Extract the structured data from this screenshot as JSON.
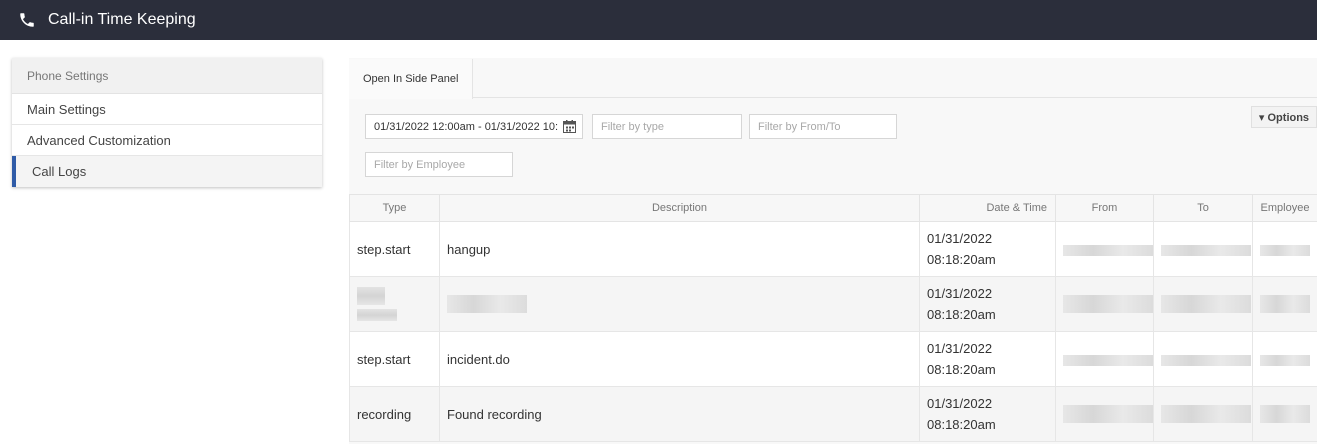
{
  "app": {
    "title": "Call-in Time Keeping",
    "icon": "phone-icon"
  },
  "sidebar": {
    "header": "Phone Settings",
    "items": [
      {
        "label": "Main Settings",
        "active": false
      },
      {
        "label": "Advanced Customization",
        "active": false
      },
      {
        "label": "Call Logs",
        "active": true
      }
    ]
  },
  "panel": {
    "tab_label": "Open In Side Panel",
    "options_label": "▾ Options"
  },
  "filters": {
    "date_range_value": "01/31/2022 12:00am - 01/31/2022 10:",
    "type_placeholder": "Filter by type",
    "from_to_placeholder": "Filter by From/To",
    "employee_placeholder": "Filter by Employee"
  },
  "table": {
    "columns": {
      "type": "Type",
      "description": "Description",
      "datetime": "Date & Time",
      "from": "From",
      "to": "To",
      "employee": "Employee"
    },
    "rows": [
      {
        "type": "step.start",
        "description": "hangup",
        "date": "01/31/2022",
        "time": "08:18:20am",
        "redacted": false
      },
      {
        "type": "",
        "description": "",
        "date": "01/31/2022",
        "time": "08:18:20am",
        "redacted": true
      },
      {
        "type": "step.start",
        "description": "incident.do",
        "date": "01/31/2022",
        "time": "08:18:20am",
        "redacted": false
      },
      {
        "type": "recording",
        "description": "Found recording",
        "date": "01/31/2022",
        "time": "08:18:20am",
        "redacted": false
      }
    ]
  },
  "colors": {
    "topbar": "#2b2e3b",
    "accent": "#2f5ba7"
  }
}
